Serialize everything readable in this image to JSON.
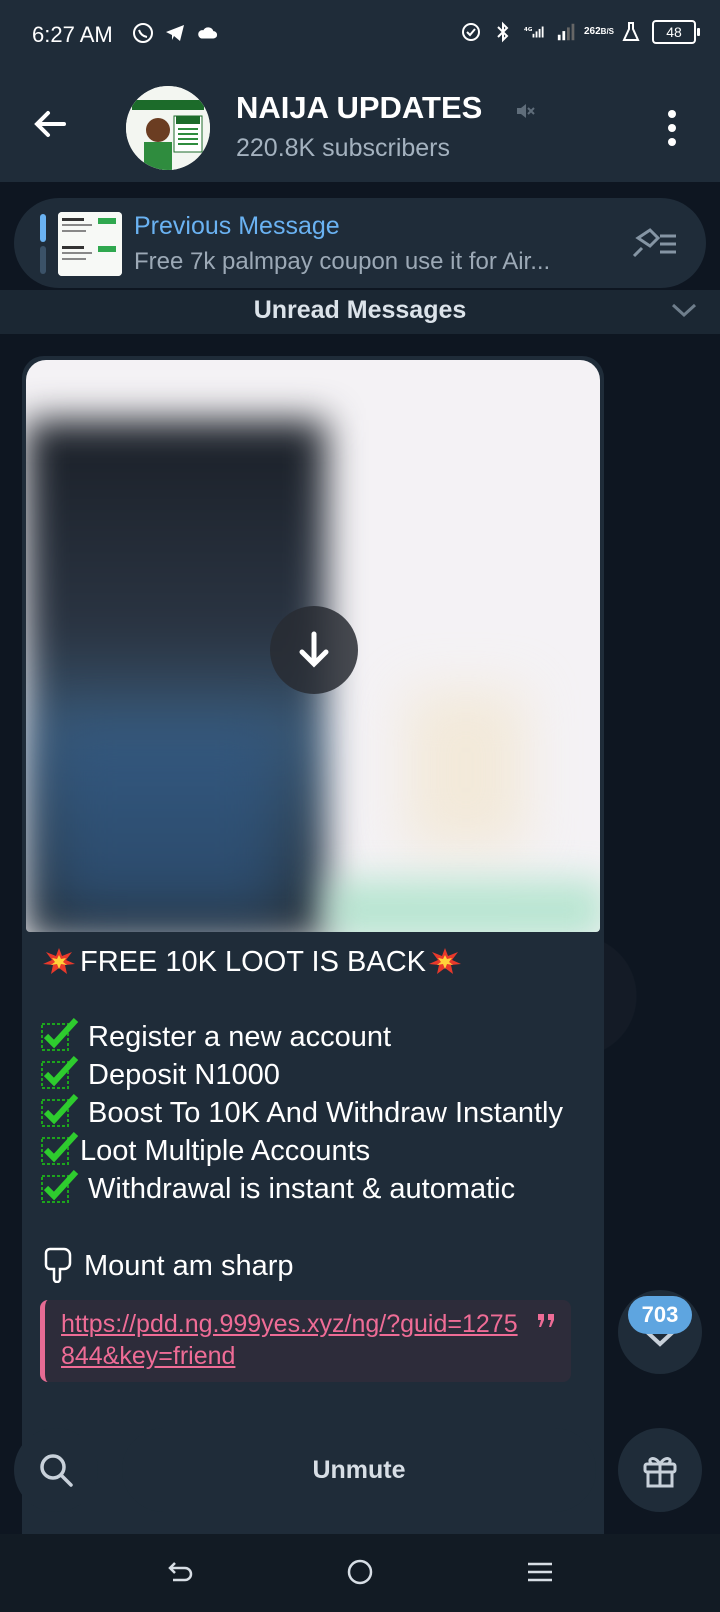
{
  "status_bar": {
    "time": "6:27 AM",
    "network": "4G",
    "speed_value": "262",
    "speed_unit": "B/S",
    "battery": "48"
  },
  "header": {
    "title": "NAIJA UPDATES",
    "subscribers": "220.8K subscribers",
    "avatar_banner": "NAIJA UPDATES"
  },
  "pinned": {
    "title": "Previous Message",
    "preview": "Free 7k palmpay coupon use it for Air..."
  },
  "unread_divider": "Unread Messages",
  "message": {
    "headline": "FREE 10K LOOT IS BACK",
    "items": [
      "Register a new account",
      "Deposit N1000",
      "Boost To 10K And Withdraw Instantly",
      "Loot Multiple Accounts",
      "Withdrawal is instant & automatic"
    ],
    "call_to_action": "Mount am sharp",
    "link": "https://pdd.ng.999yes.xyz/ng/?guid=1275844&key=friend"
  },
  "scroll_badge": "703",
  "bottom": {
    "unmute_label": "Unmute"
  },
  "colors": {
    "accent": "#6ab2f2",
    "link": "#ef6c96",
    "bubble": "#1f2c39",
    "background": "#0e1621"
  }
}
